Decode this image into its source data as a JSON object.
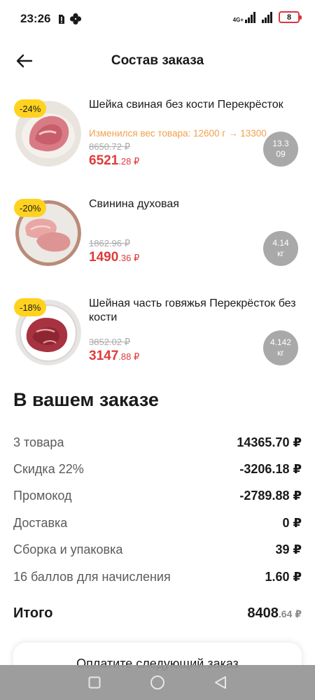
{
  "status_bar": {
    "time": "23:26",
    "network_label_top": "4G+",
    "battery_level": "8"
  },
  "header": {
    "title": "Состав заказа"
  },
  "products": [
    {
      "discount": "-24%",
      "name": "Шейка свиная без кости Перекрёсток",
      "weight_notice": "Изменился вес товара: 12600 г → 13300",
      "old_price": "8650.72 ₽",
      "price_rub": "6521",
      "price_kop": ".28 ₽",
      "qty_line1": "13.3",
      "qty_line2": "09"
    },
    {
      "discount": "-20%",
      "name": "Свинина духовая",
      "weight_notice": "",
      "old_price": "1862.96 ₽",
      "price_rub": "1490",
      "price_kop": ".36 ₽",
      "qty_line1": "4.14",
      "qty_line2": "кг"
    },
    {
      "discount": "-18%",
      "name": "Шейная часть говяжья Перекрёсток без кости",
      "weight_notice": "",
      "old_price": "3852.02 ₽",
      "price_rub": "3147",
      "price_kop": ".88 ₽",
      "qty_line1": "4.142",
      "qty_line2": "кг"
    }
  ],
  "summary": {
    "title": "В вашем заказе",
    "rows": [
      {
        "label": "3 товара",
        "value": "14365.70 ₽"
      },
      {
        "label": "Скидка 22%",
        "value": "-3206.18 ₽"
      },
      {
        "label": "Промокод",
        "value": "-2789.88 ₽"
      },
      {
        "label": "Доставка",
        "value": "0 ₽"
      },
      {
        "label": "Сборка и упаковка",
        "value": "39 ₽"
      },
      {
        "label": "16 баллов для начисления",
        "value": "1.60 ₽"
      }
    ],
    "total_label": "Итого",
    "total_rub": "8408",
    "total_kop": ".64",
    "total_currency": " ₽"
  },
  "pay_card": {
    "text": "Оплатите следующий заказ"
  },
  "colors": {
    "accent_red": "#e03a3a",
    "badge_yellow": "#ffd21f",
    "notice_orange": "#f0a04b",
    "qty_grey": "#a9a9a9"
  }
}
